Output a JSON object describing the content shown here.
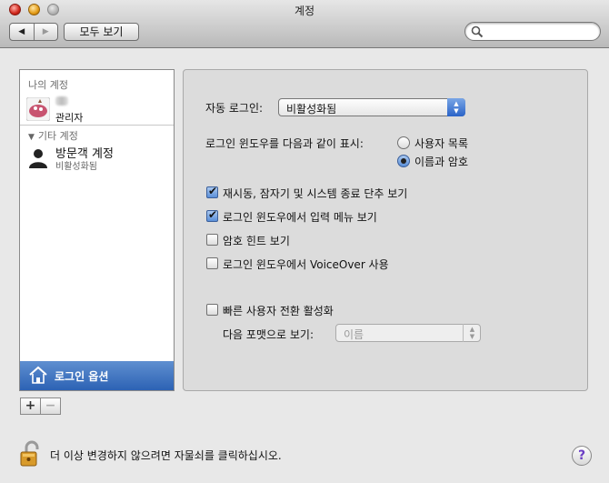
{
  "window": {
    "title": "계정"
  },
  "toolbar": {
    "back_label": "◀",
    "forward_label": "▶",
    "show_all_label": "모두 보기",
    "search_value": ""
  },
  "sidebar": {
    "my_account_header": "나의 계정",
    "my_account": {
      "role": "관리자"
    },
    "other_accounts_header": "기타 계정",
    "guest": {
      "name": "방문객 계정",
      "status": "비활성화됨"
    },
    "login_options_label": "로그인 옵션",
    "add_label": "+",
    "remove_label": "−"
  },
  "panel": {
    "auto_login_label": "자동 로그인:",
    "auto_login_value": "비활성화됨",
    "display_label": "로그인 윈도우를 다음과 같이 표시:",
    "radio_user_list": "사용자 목록",
    "radio_name_password": "이름과 암호",
    "selected_display": "name_password",
    "checkboxes": [
      {
        "label": "재시동, 잠자기 및 시스템 종료 단추 보기",
        "checked": true
      },
      {
        "label": "로그인 윈도우에서 입력 메뉴 보기",
        "checked": true
      },
      {
        "label": "암호 힌트 보기",
        "checked": false
      },
      {
        "label": "로그인 윈도우에서 VoiceOver 사용",
        "checked": false
      }
    ],
    "fast_switch_label": "빠른 사용자 전환 활성화",
    "fast_switch_checked": false,
    "view_format_label": "다음 포맷으로 보기:",
    "view_format_value": "이름"
  },
  "footer": {
    "lock_text": "더 이상 변경하지 않으려면 자물쇠를 클릭하십시오.",
    "help_label": "?"
  },
  "colors": {
    "selection_blue": "#2c62b4",
    "window_bg": "#e8e8e8"
  }
}
